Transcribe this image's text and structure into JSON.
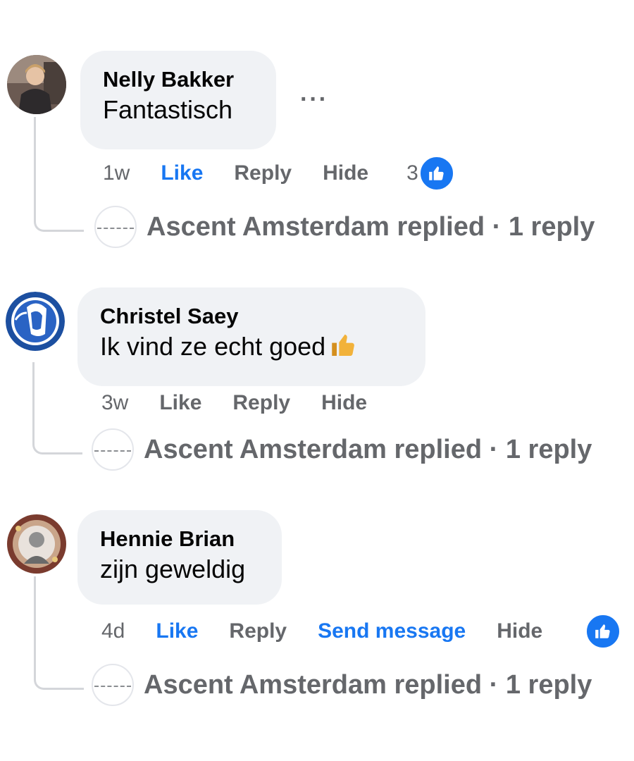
{
  "comments": [
    {
      "author": "Nelly Bakker",
      "text": "Fantastisch",
      "time": "1w",
      "like_label": "Like",
      "reply_label": "Reply",
      "hide_label": "Hide",
      "liked": true,
      "reaction_count": "3",
      "more_label": "···",
      "replied_text": "Ascent Amsterdam replied · 1 reply"
    },
    {
      "author": "Christel Saey",
      "text": "Ik vind ze echt goed",
      "emoji": "thumbs-up",
      "time": "3w",
      "like_label": "Like",
      "reply_label": "Reply",
      "hide_label": "Hide",
      "liked": false,
      "replied_text": "Ascent Amsterdam replied · 1 reply"
    },
    {
      "author": "Hennie Brian",
      "text": "zijn geweldig",
      "time": "4d",
      "like_label": "Like",
      "reply_label": "Reply",
      "send_message_label": "Send message",
      "hide_label": "Hide",
      "liked": true,
      "replied_text": "Ascent Amsterdam replied · 1 reply"
    }
  ],
  "colors": {
    "accent": "#1877f2",
    "bubble": "#f0f2f5",
    "muted": "#65676b",
    "thread_line": "#d4d6da"
  }
}
